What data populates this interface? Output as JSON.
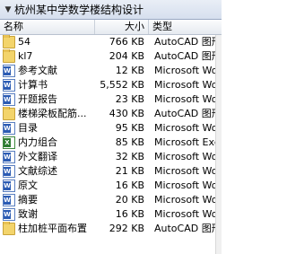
{
  "window": {
    "title": "杭州某中学数学楼结构设计"
  },
  "columns": {
    "name": "名称",
    "size": "大小",
    "type": "类型"
  },
  "files": [
    {
      "name": "54",
      "size": "766 KB",
      "type": "AutoCAD 图形",
      "icon": "folder-icon"
    },
    {
      "name": "kl7",
      "size": "204 KB",
      "type": "AutoCAD 图形",
      "icon": "folder-icon"
    },
    {
      "name": "参考文献",
      "size": "12 KB",
      "type": "Microsoft Word",
      "icon": "word-doc-icon"
    },
    {
      "name": "计算书",
      "size": "5,552 KB",
      "type": "Microsoft Word",
      "icon": "word-doc-icon"
    },
    {
      "name": "开题报告",
      "size": "23 KB",
      "type": "Microsoft Word",
      "icon": "word-doc-icon"
    },
    {
      "name": "楼梯梁板配筋...",
      "size": "430 KB",
      "type": "AutoCAD 图形",
      "icon": "folder-icon"
    },
    {
      "name": "目录",
      "size": "95 KB",
      "type": "Microsoft Word",
      "icon": "word-doc-icon"
    },
    {
      "name": "内力组合",
      "size": "85 KB",
      "type": "Microsoft Excel",
      "icon": "excel-icon"
    },
    {
      "name": "外文翻译",
      "size": "32 KB",
      "type": "Microsoft Word",
      "icon": "word-doc-icon"
    },
    {
      "name": "文献综述",
      "size": "21 KB",
      "type": "Microsoft Word",
      "icon": "word-doc-icon"
    },
    {
      "name": "原文",
      "size": "16 KB",
      "type": "Microsoft Word",
      "icon": "word-doc-icon"
    },
    {
      "name": "摘要",
      "size": "20 KB",
      "type": "Microsoft Word",
      "icon": "word-doc-icon"
    },
    {
      "name": "致谢",
      "size": "16 KB",
      "type": "Microsoft Word",
      "icon": "word-doc-icon"
    },
    {
      "name": "柱加桩平面布置",
      "size": "292 KB",
      "type": "AutoCAD 图形",
      "icon": "folder-icon"
    }
  ]
}
